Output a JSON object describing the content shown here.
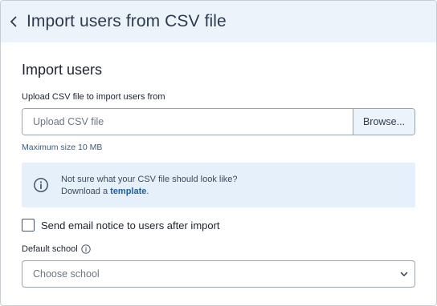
{
  "header": {
    "title": "Import users from CSV file"
  },
  "main": {
    "section_title": "Import users",
    "upload": {
      "label": "Upload CSV file to import users from",
      "placeholder": "Upload CSV file",
      "browse_label": "Browse...",
      "hint": "Maximum size 10 MB"
    },
    "info": {
      "line1": "Not sure what your CSV file should look like?",
      "line2_prefix": "Download a ",
      "line2_link": "template",
      "line2_suffix": "."
    },
    "email_notice": {
      "label": "Send email notice to users after import",
      "checked": false
    },
    "default_school": {
      "label": "Default school",
      "placeholder": "Choose school"
    }
  },
  "colors": {
    "header_bg": "#edf3fa",
    "info_bg": "#e6f0fa",
    "link": "#1d5fa8"
  },
  "icons": [
    "chevron-left-icon",
    "info-icon",
    "help-circle-icon",
    "chevron-down-icon"
  ]
}
